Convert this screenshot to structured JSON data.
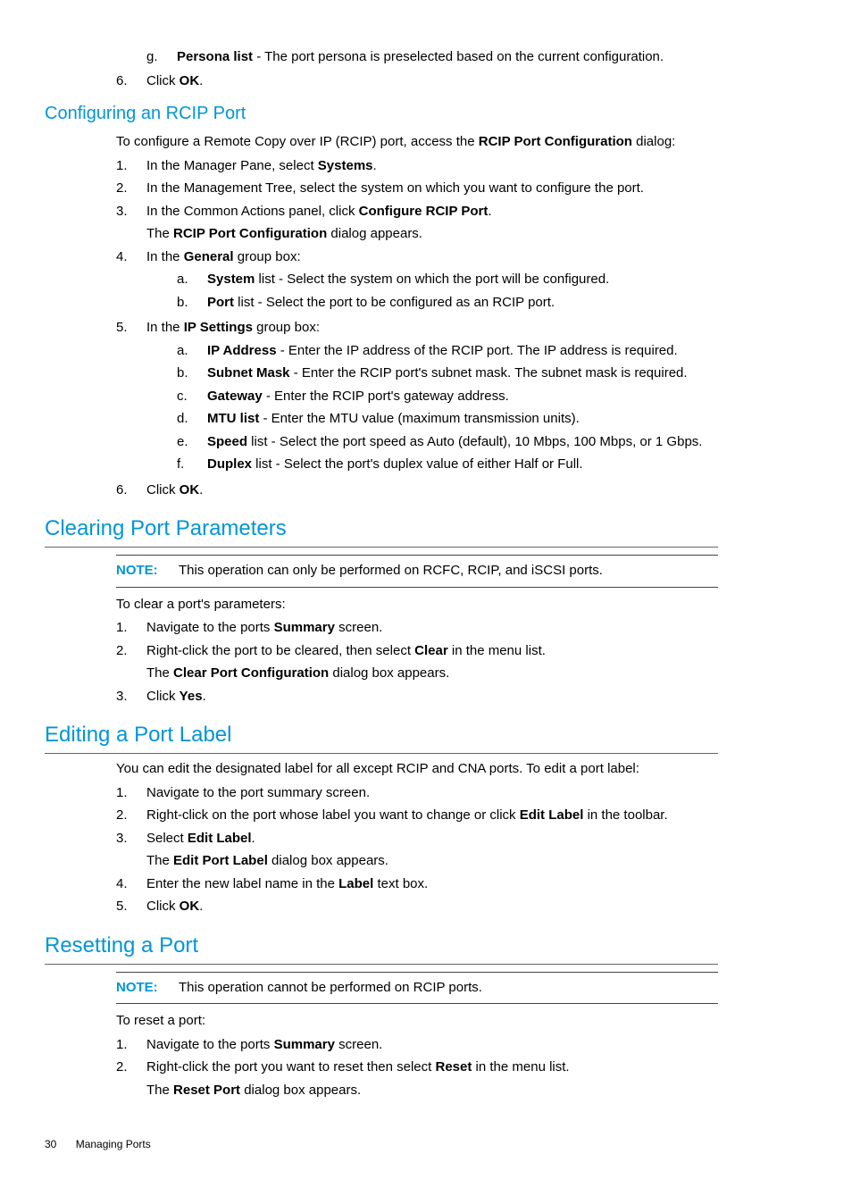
{
  "top": {
    "personaItem": {
      "marker": "g.",
      "label": "Persona list",
      "after": " - The port persona is preselected based on the current configuration."
    },
    "step6": {
      "marker": "6.",
      "prefix": "Click ",
      "bold": "OK",
      "after": "."
    }
  },
  "s1": {
    "heading": "Configuring an RCIP Port",
    "intro": {
      "before": "To configure a Remote Copy over IP (RCIP) port, access the ",
      "bold": "RCIP Port Configuration",
      "after": " dialog:"
    },
    "steps": {
      "1": {
        "marker": "1.",
        "before": "In the Manager Pane, select ",
        "bold": "Systems",
        "after": "."
      },
      "2": {
        "marker": "2.",
        "text": "In the Management Tree, select the system on which you want to configure the port."
      },
      "3": {
        "marker": "3.",
        "before": "In the Common Actions panel, click ",
        "bold": "Configure RCIP Port",
        "after": ".",
        "sub": {
          "before": "The ",
          "bold": "RCIP Port Configuration",
          "after": " dialog appears."
        }
      },
      "4": {
        "marker": "4.",
        "before": "In the ",
        "bold": "General",
        "after": " group box:",
        "a": {
          "marker": "a.",
          "label": "System",
          "after": " list - Select the system on which the port will be configured."
        },
        "b": {
          "marker": "b.",
          "label": "Port",
          "after": " list - Select the port to be configured as an RCIP port."
        }
      },
      "5": {
        "marker": "5.",
        "before": "In the ",
        "bold": "IP Settings",
        "after": " group box:",
        "a": {
          "marker": "a.",
          "label": "IP Address ",
          "after": " - Enter the IP address of the RCIP port. The IP address is required."
        },
        "b": {
          "marker": "b.",
          "label": "Subnet Mask",
          "after": " - Enter the RCIP port's subnet mask. The subnet mask is required."
        },
        "c": {
          "marker": "c.",
          "label": "Gateway",
          "after": " - Enter the RCIP port's gateway address."
        },
        "d": {
          "marker": "d.",
          "label": "MTU list",
          "after": " - Enter the MTU value (maximum transmission units)."
        },
        "e": {
          "marker": "e.",
          "label": "Speed",
          "after": " list - Select the port speed as Auto (default), 10 Mbps, 100 Mbps, or 1 Gbps."
        },
        "f": {
          "marker": "f.",
          "label": "Duplex",
          "after": " list - Select the port's duplex value of either Half or Full."
        }
      },
      "6": {
        "marker": "6.",
        "prefix": "Click ",
        "bold": "OK",
        "after": "."
      }
    }
  },
  "s2": {
    "heading": "Clearing Port Parameters",
    "note": {
      "label": "NOTE:",
      "text": "This operation can only be performed on RCFC, RCIP, and iSCSI ports."
    },
    "intro": "To clear a port's parameters:",
    "steps": {
      "1": {
        "marker": "1.",
        "before": "Navigate to the ports ",
        "bold": "Summary",
        "after": " screen."
      },
      "2": {
        "marker": "2.",
        "before": "Right-click the port to be cleared, then select ",
        "bold": "Clear",
        "after": " in the menu list.",
        "sub": {
          "before": "The ",
          "bold": "Clear Port Configuration",
          "after": " dialog box appears."
        }
      },
      "3": {
        "marker": "3.",
        "prefix": "Click ",
        "bold": "Yes",
        "after": "."
      }
    }
  },
  "s3": {
    "heading": "Editing a Port Label",
    "intro": "You can edit the designated label for all except RCIP and CNA ports. To edit a port label:",
    "steps": {
      "1": {
        "marker": "1.",
        "text": "Navigate to the port summary screen."
      },
      "2": {
        "marker": "2.",
        "before": "Right-click on the port whose label you want to change or click ",
        "bold": "Edit Label",
        "after": " in the toolbar."
      },
      "3": {
        "marker": "3.",
        "before": "Select ",
        "bold": "Edit Label",
        "after": ".",
        "sub": {
          "before": "The ",
          "bold": "Edit Port Label",
          "after": " dialog box appears."
        }
      },
      "4": {
        "marker": "4.",
        "before": "Enter the new label name in the ",
        "bold": "Label",
        "after": " text box."
      },
      "5": {
        "marker": "5.",
        "prefix": "Click ",
        "bold": "OK",
        "after": "."
      }
    }
  },
  "s4": {
    "heading": "Resetting a Port",
    "note": {
      "label": "NOTE:",
      "text": "This operation cannot be performed on RCIP ports."
    },
    "intro": "To reset a port:",
    "steps": {
      "1": {
        "marker": "1.",
        "before": "Navigate to the ports ",
        "bold": "Summary",
        "after": " screen."
      },
      "2": {
        "marker": "2.",
        "before": "Right-click the port you want to reset then select ",
        "bold": "Reset",
        "after": " in the menu list.",
        "sub": {
          "before": "The ",
          "bold": "Reset Port",
          "after": " dialog box appears."
        }
      }
    }
  },
  "footer": {
    "page": "30",
    "section": "Managing Ports"
  }
}
